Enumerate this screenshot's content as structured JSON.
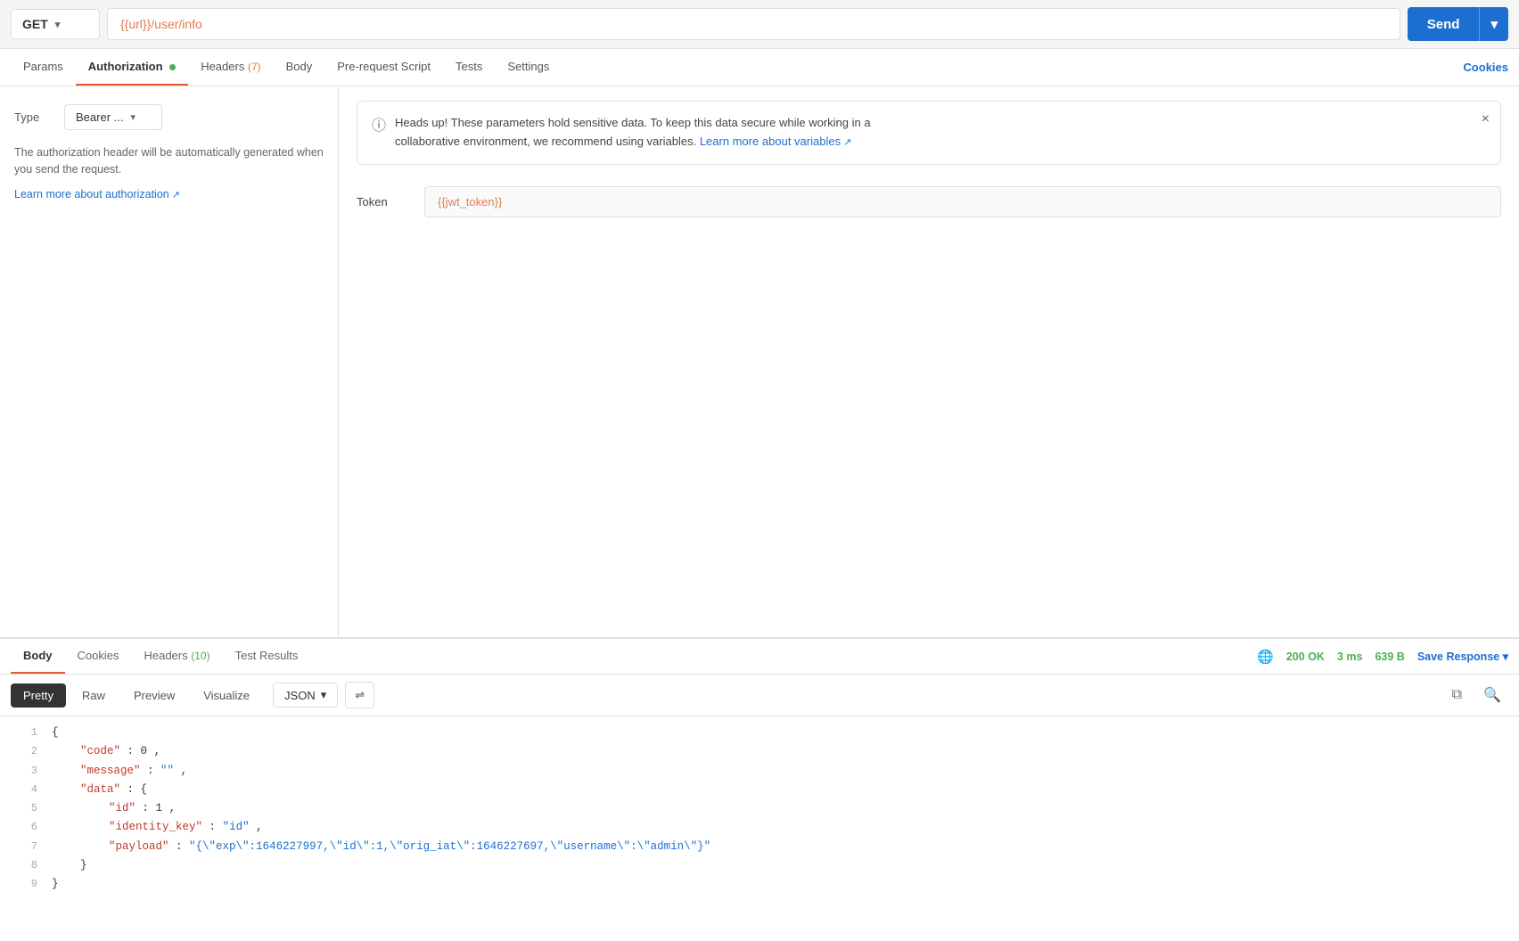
{
  "topbar": {
    "method": "GET",
    "url": "{{url}}/user/info",
    "send_label": "Send",
    "send_chevron": "▾"
  },
  "tabs": {
    "items": [
      {
        "id": "params",
        "label": "Params",
        "active": false
      },
      {
        "id": "authorization",
        "label": "Authorization",
        "active": true,
        "dot": true
      },
      {
        "id": "headers",
        "label": "Headers",
        "active": false,
        "badge": "(7)"
      },
      {
        "id": "body",
        "label": "Body",
        "active": false
      },
      {
        "id": "prerequest",
        "label": "Pre-request Script",
        "active": false
      },
      {
        "id": "tests",
        "label": "Tests",
        "active": false
      },
      {
        "id": "settings",
        "label": "Settings",
        "active": false
      }
    ],
    "cookies_label": "Cookies"
  },
  "auth": {
    "type_label": "Type",
    "type_value": "Bearer ...",
    "description": "The authorization header will be automatically generated when you send the request.",
    "learn_link": "Learn more about authorization",
    "alert": {
      "text1": "Heads up! These parameters hold sensitive data. To keep this data secure while working in a",
      "text2": "collaborative environment, we recommend using variables.",
      "link_text": "Learn more about variables"
    },
    "token_label": "Token",
    "token_value": "{{jwt_token}}"
  },
  "response": {
    "tabs": [
      {
        "id": "body",
        "label": "Body",
        "active": true
      },
      {
        "id": "cookies",
        "label": "Cookies",
        "active": false
      },
      {
        "id": "headers",
        "label": "Headers",
        "active": false,
        "badge": "(10)"
      },
      {
        "id": "test-results",
        "label": "Test Results",
        "active": false
      }
    ],
    "status": "200 OK",
    "time": "3 ms",
    "size": "639 B",
    "save_label": "Save Response",
    "format_buttons": [
      "Pretty",
      "Raw",
      "Preview",
      "Visualize"
    ],
    "active_format": "Pretty",
    "lang_dropdown": "JSON",
    "code_lines": [
      {
        "num": 1,
        "content": "{"
      },
      {
        "num": 2,
        "content": "\"code\": 0,"
      },
      {
        "num": 3,
        "content": "\"message\": \"\","
      },
      {
        "num": 4,
        "content": "\"data\": {"
      },
      {
        "num": 5,
        "content": "\"id\": 1,"
      },
      {
        "num": 6,
        "content": "\"identity_key\": \"id\","
      },
      {
        "num": 7,
        "content": "\"payload\": \"{\\\"exp\\\":1646227997,\\\"id\\\":1,\\\"orig_iat\\\":1646227697,\\\"username\\\":\\\"admin\\\"}\""
      },
      {
        "num": 8,
        "content": "}"
      },
      {
        "num": 9,
        "content": "}"
      }
    ]
  }
}
